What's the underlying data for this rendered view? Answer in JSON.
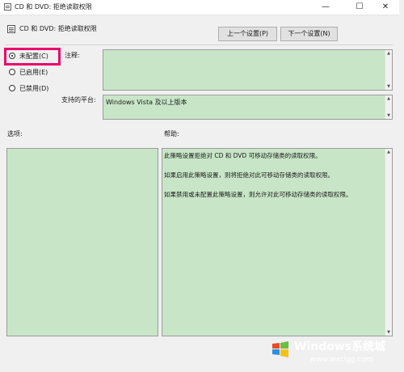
{
  "window": {
    "title": "CD 和 DVD: 拒绝读取权限",
    "min_glyph": "—",
    "max_glyph": "☐",
    "close_glyph": "✕"
  },
  "header": {
    "title": "CD 和 DVD: 拒绝读取权限",
    "prev_button": "上一个设置(P)",
    "next_button": "下一个设置(N)"
  },
  "options": {
    "selected": "not_configured",
    "items": [
      {
        "id": "not_configured",
        "label": "未配置(C)"
      },
      {
        "id": "enabled",
        "label": "已启用(E)"
      },
      {
        "id": "disabled",
        "label": "已禁用(D)"
      }
    ]
  },
  "comment": {
    "label": "注释:",
    "value": ""
  },
  "platform": {
    "label": "支持的平台:",
    "value": "Windows Vista 及以上版本"
  },
  "options_section": {
    "label": "选项:"
  },
  "help_section": {
    "label": "帮助:",
    "paragraphs": [
      "此策略设置拒绝对 CD 和 DVD 可移动存储类的读取权限。",
      "如果启用此策略设置，则将拒绝对此可移动存储类的读取权限。",
      "如果禁用或未配置此策略设置，则允许对此可移动存储类的读取权限。"
    ]
  },
  "watermark": {
    "brand": "Windows系统城",
    "url": "www.wxclgg.com"
  },
  "colors": {
    "field_green": "#c8e6c7",
    "highlight": "#e8086a"
  }
}
